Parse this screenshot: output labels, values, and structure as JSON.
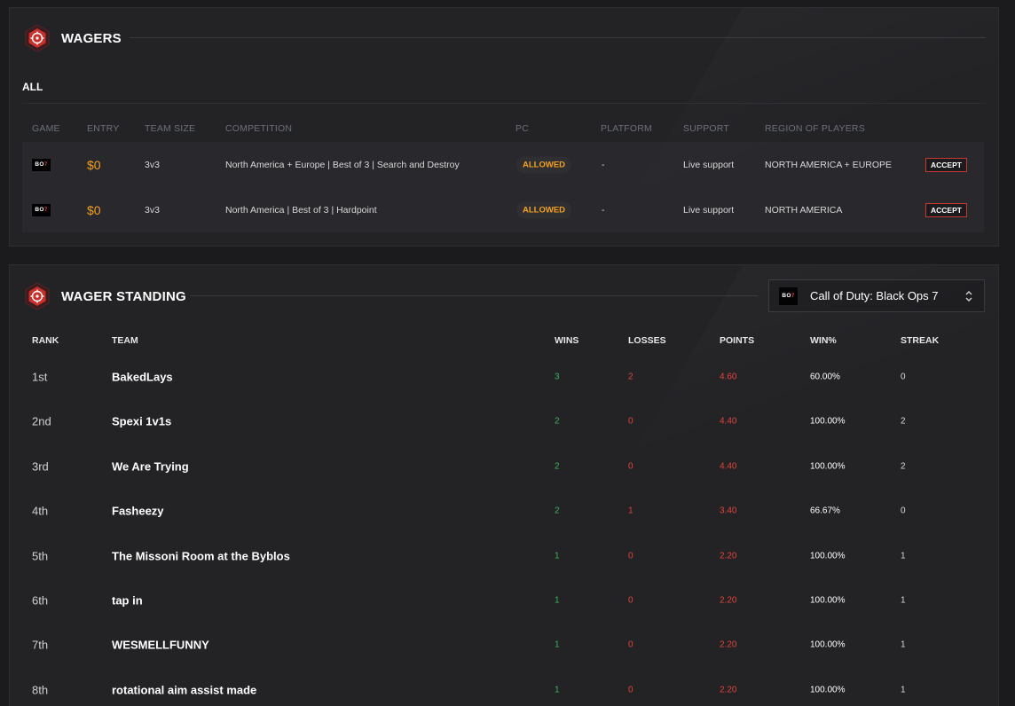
{
  "wagers": {
    "title": "WAGERS",
    "filter": "ALL",
    "columns": [
      "GAME",
      "ENTRY",
      "TEAM SIZE",
      "COMPETITION",
      "PC",
      "PLATFORM",
      "SUPPORT",
      "REGION OF PLAYERS"
    ],
    "rows": [
      {
        "game_logo": "BO7",
        "entry": "$0",
        "team_size": "3v3",
        "competition": "North America + Europe | Best of 3 | Search and Destroy",
        "pc": "ALLOWED",
        "platform": "-",
        "support": "Live support",
        "region": "NORTH AMERICA + EUROPE",
        "action": "ACCEPT"
      },
      {
        "game_logo": "BO7",
        "entry": "$0",
        "team_size": "3v3",
        "competition": "North America | Best of 3 | Hardpoint",
        "pc": "ALLOWED",
        "platform": "-",
        "support": "Live support",
        "region": "NORTH AMERICA",
        "action": "ACCEPT"
      }
    ]
  },
  "standing": {
    "title": "WAGER STANDING",
    "game_select": {
      "logo": "BO7",
      "value": "Call of Duty: Black Ops 7"
    },
    "columns": [
      "RANK",
      "TEAM",
      "WINS",
      "LOSSES",
      "POINTS",
      "WIN%",
      "STREAK"
    ],
    "rows": [
      {
        "rank": "1st",
        "team": "BakedLays",
        "wins": "3",
        "losses": "2",
        "points": "4.60",
        "win_pct": "60.00%",
        "streak": "0"
      },
      {
        "rank": "2nd",
        "team": "Spexi 1v1s",
        "wins": "2",
        "losses": "0",
        "points": "4.40",
        "win_pct": "100.00%",
        "streak": "2"
      },
      {
        "rank": "3rd",
        "team": "We Are Trying",
        "wins": "2",
        "losses": "0",
        "points": "4.40",
        "win_pct": "100.00%",
        "streak": "2"
      },
      {
        "rank": "4th",
        "team": "Fasheezy",
        "wins": "2",
        "losses": "1",
        "points": "3.40",
        "win_pct": "66.67%",
        "streak": "0"
      },
      {
        "rank": "5th",
        "team": "The Missoni Room at the Byblos",
        "wins": "1",
        "losses": "0",
        "points": "2.20",
        "win_pct": "100.00%",
        "streak": "1"
      },
      {
        "rank": "6th",
        "team": "tap in",
        "wins": "1",
        "losses": "0",
        "points": "2.20",
        "win_pct": "100.00%",
        "streak": "1"
      },
      {
        "rank": "7th",
        "team": "WESMELLFUNNY",
        "wins": "1",
        "losses": "0",
        "points": "2.20",
        "win_pct": "100.00%",
        "streak": "1"
      },
      {
        "rank": "8th",
        "team": "rotational aim assist made",
        "wins": "1",
        "losses": "0",
        "points": "2.20",
        "win_pct": "100.00%",
        "streak": "1"
      }
    ]
  },
  "colors": {
    "accent_red": "#e0443b",
    "win_green": "#3cb35a",
    "entry_orange": "#f5a020"
  }
}
